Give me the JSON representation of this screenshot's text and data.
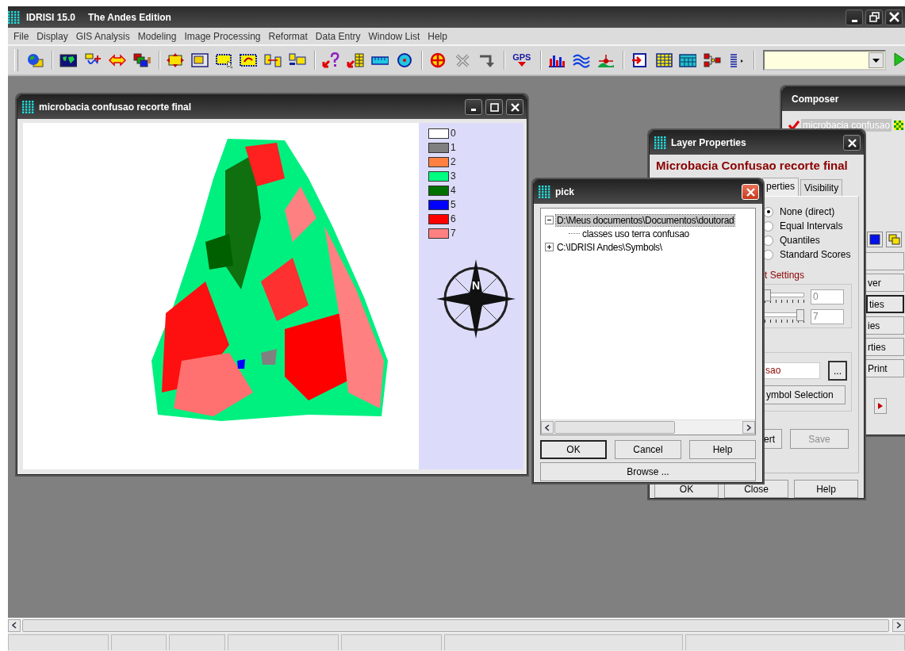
{
  "app": {
    "title": "IDRISI 15.0",
    "edition": "The Andes Edition"
  },
  "menu": [
    "File",
    "Display",
    "GIS Analysis",
    "Modeling",
    "Image Processing",
    "Reformat",
    "Data Entry",
    "Window List",
    "Help"
  ],
  "toolbar": {
    "gps_label": "GPS"
  },
  "map_window": {
    "title": "microbacia confusao recorte final",
    "compass_label": "N",
    "legend": [
      {
        "label": "0",
        "color": "#ffffff"
      },
      {
        "label": "1",
        "color": "#808080"
      },
      {
        "label": "2",
        "color": "#ff8040"
      },
      {
        "label": "3",
        "color": "#00ff80"
      },
      {
        "label": "4",
        "color": "#007000"
      },
      {
        "label": "5",
        "color": "#0000ff"
      },
      {
        "label": "6",
        "color": "#ff0000"
      },
      {
        "label": "7",
        "color": "#ff8080"
      }
    ]
  },
  "composer": {
    "title": "Composer",
    "layers": [
      {
        "name": "microbacia confusao",
        "checked": true,
        "selected": true
      }
    ],
    "buttons": [
      {
        "label": "ver",
        "focused": false
      },
      {
        "label": "ties",
        "focused": true
      },
      {
        "label": "ies",
        "focused": false
      },
      {
        "label": "rties",
        "focused": false
      },
      {
        "label": "Print",
        "focused": false
      }
    ]
  },
  "layer_properties": {
    "title": "Layer Properties",
    "heading": "Microbacia Confusao recorte final",
    "tabs": [
      {
        "label": "perties",
        "selected": true
      },
      {
        "label": "Visibility",
        "selected": false
      }
    ],
    "stretch_options": [
      {
        "label": "None (direct)",
        "selected": true
      },
      {
        "label": "Equal Intervals",
        "selected": false
      },
      {
        "label": "Quantiles",
        "selected": false
      },
      {
        "label": "Standard Scores",
        "selected": false
      }
    ],
    "settings_label": "t Settings",
    "sliders": [
      {
        "value": "0",
        "level": 0
      },
      {
        "value": "7",
        "level": 1
      }
    ],
    "palette_field": "sao",
    "browse_button": "...",
    "symbol_button": "ymbol Selection",
    "action_buttons": [
      {
        "label": "ert",
        "disabled": false
      },
      {
        "label": "Save",
        "disabled": true
      }
    ],
    "buttons": [
      "OK",
      "Close",
      "Help"
    ]
  },
  "pick": {
    "title": "pick",
    "tree": [
      {
        "label": "D:\\Meus documentos\\Documentos\\doutorad",
        "expanded": true,
        "selected": true,
        "children": [
          {
            "label": "classes uso terra confusao",
            "selected": false
          }
        ]
      },
      {
        "label": "C:\\IDRISI Andes\\Symbols\\",
        "expanded": false,
        "selected": false
      }
    ],
    "buttons": [
      {
        "label": "OK",
        "default": true
      },
      {
        "label": "Cancel",
        "default": false
      },
      {
        "label": "Help",
        "default": false
      }
    ],
    "browse_button": "Browse ..."
  }
}
